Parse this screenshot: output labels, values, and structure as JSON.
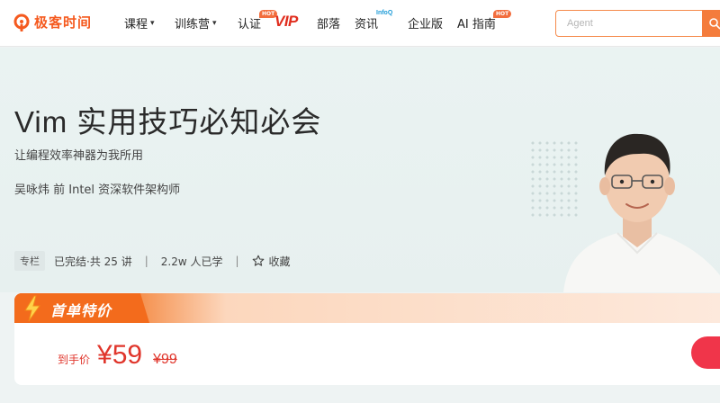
{
  "header": {
    "logo_text": "极客时间",
    "nav": [
      {
        "label": "课程",
        "chevron": true
      },
      {
        "label": "训练营",
        "chevron": true
      },
      {
        "label": "认证",
        "badge": "HOT"
      },
      {
        "label": "VIP"
      },
      {
        "label": "部落"
      },
      {
        "label": "资讯",
        "badge": "InfoQ"
      },
      {
        "label": "企业版"
      },
      {
        "label": "AI 指南",
        "badge": "HOT"
      }
    ],
    "search_placeholder": "Agent"
  },
  "hero": {
    "title": "Vim 实用技巧必知必会",
    "subtitle": "让编程效率神器为我所用",
    "author": "吴咏炜  前 Intel 资深软件架构师",
    "tag": "专栏",
    "status": "已完结·共 25 讲",
    "learners": "2.2w 人已学",
    "favorite": "收藏"
  },
  "price": {
    "promo": "首单特价",
    "label": "到手价",
    "current": "¥59",
    "original": "¥99"
  },
  "colors": {
    "brand": "#f55a1f",
    "accent_red": "#e0352b",
    "vip": "#e02d1e",
    "buy_button": "#f0354a"
  }
}
